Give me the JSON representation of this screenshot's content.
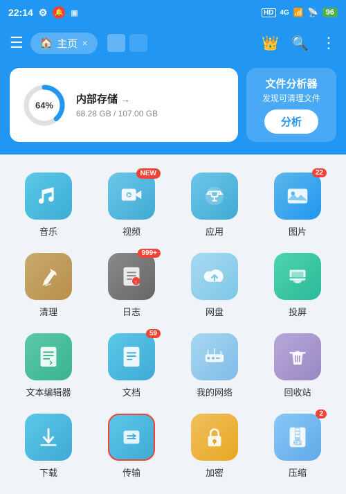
{
  "statusBar": {
    "time": "22:14",
    "icons": [
      "settings",
      "notification",
      "hd",
      "4g",
      "signal",
      "wifi",
      "battery"
    ],
    "battery": "96"
  },
  "toolbar": {
    "homeTab": "主页",
    "closeLabel": "×"
  },
  "storageCard": {
    "percent": "64%",
    "title": "内部存储",
    "used": "68.28 GB / 107.00 GB"
  },
  "analyzer": {
    "title": "文件分析器",
    "subtitle": "发现可清理文件",
    "buttonLabel": "分析"
  },
  "grid": [
    {
      "label": "音乐",
      "iconClass": "ic-music",
      "badge": "",
      "badgeType": ""
    },
    {
      "label": "视频",
      "iconClass": "ic-video",
      "badge": "NEW",
      "badgeType": "new"
    },
    {
      "label": "应用",
      "iconClass": "ic-app",
      "badge": "",
      "badgeType": ""
    },
    {
      "label": "图片",
      "iconClass": "ic-photo",
      "badge": "22",
      "badgeType": "count"
    },
    {
      "label": "清理",
      "iconClass": "ic-clean",
      "badge": "",
      "badgeType": ""
    },
    {
      "label": "日志",
      "iconClass": "ic-log",
      "badge": "999+",
      "badgeType": "count"
    },
    {
      "label": "网盘",
      "iconClass": "ic-cloud",
      "badge": "",
      "badgeType": ""
    },
    {
      "label": "投屏",
      "iconClass": "ic-cast",
      "badge": "",
      "badgeType": ""
    },
    {
      "label": "文本编辑器",
      "iconClass": "ic-text",
      "badge": "",
      "badgeType": ""
    },
    {
      "label": "文档",
      "iconClass": "ic-doc",
      "badge": "59",
      "badgeType": "count"
    },
    {
      "label": "我的网络",
      "iconClass": "ic-network",
      "badge": "",
      "badgeType": ""
    },
    {
      "label": "回收站",
      "iconClass": "ic-trash",
      "badge": "",
      "badgeType": ""
    },
    {
      "label": "下载",
      "iconClass": "ic-download",
      "badge": "",
      "badgeType": ""
    },
    {
      "label": "传输",
      "iconClass": "ic-transfer",
      "badge": "",
      "badgeType": ""
    },
    {
      "label": "加密",
      "iconClass": "ic-lock",
      "badge": "",
      "badgeType": ""
    },
    {
      "label": "压缩",
      "iconClass": "ic-zip",
      "badge": "2",
      "badgeType": "count"
    }
  ]
}
